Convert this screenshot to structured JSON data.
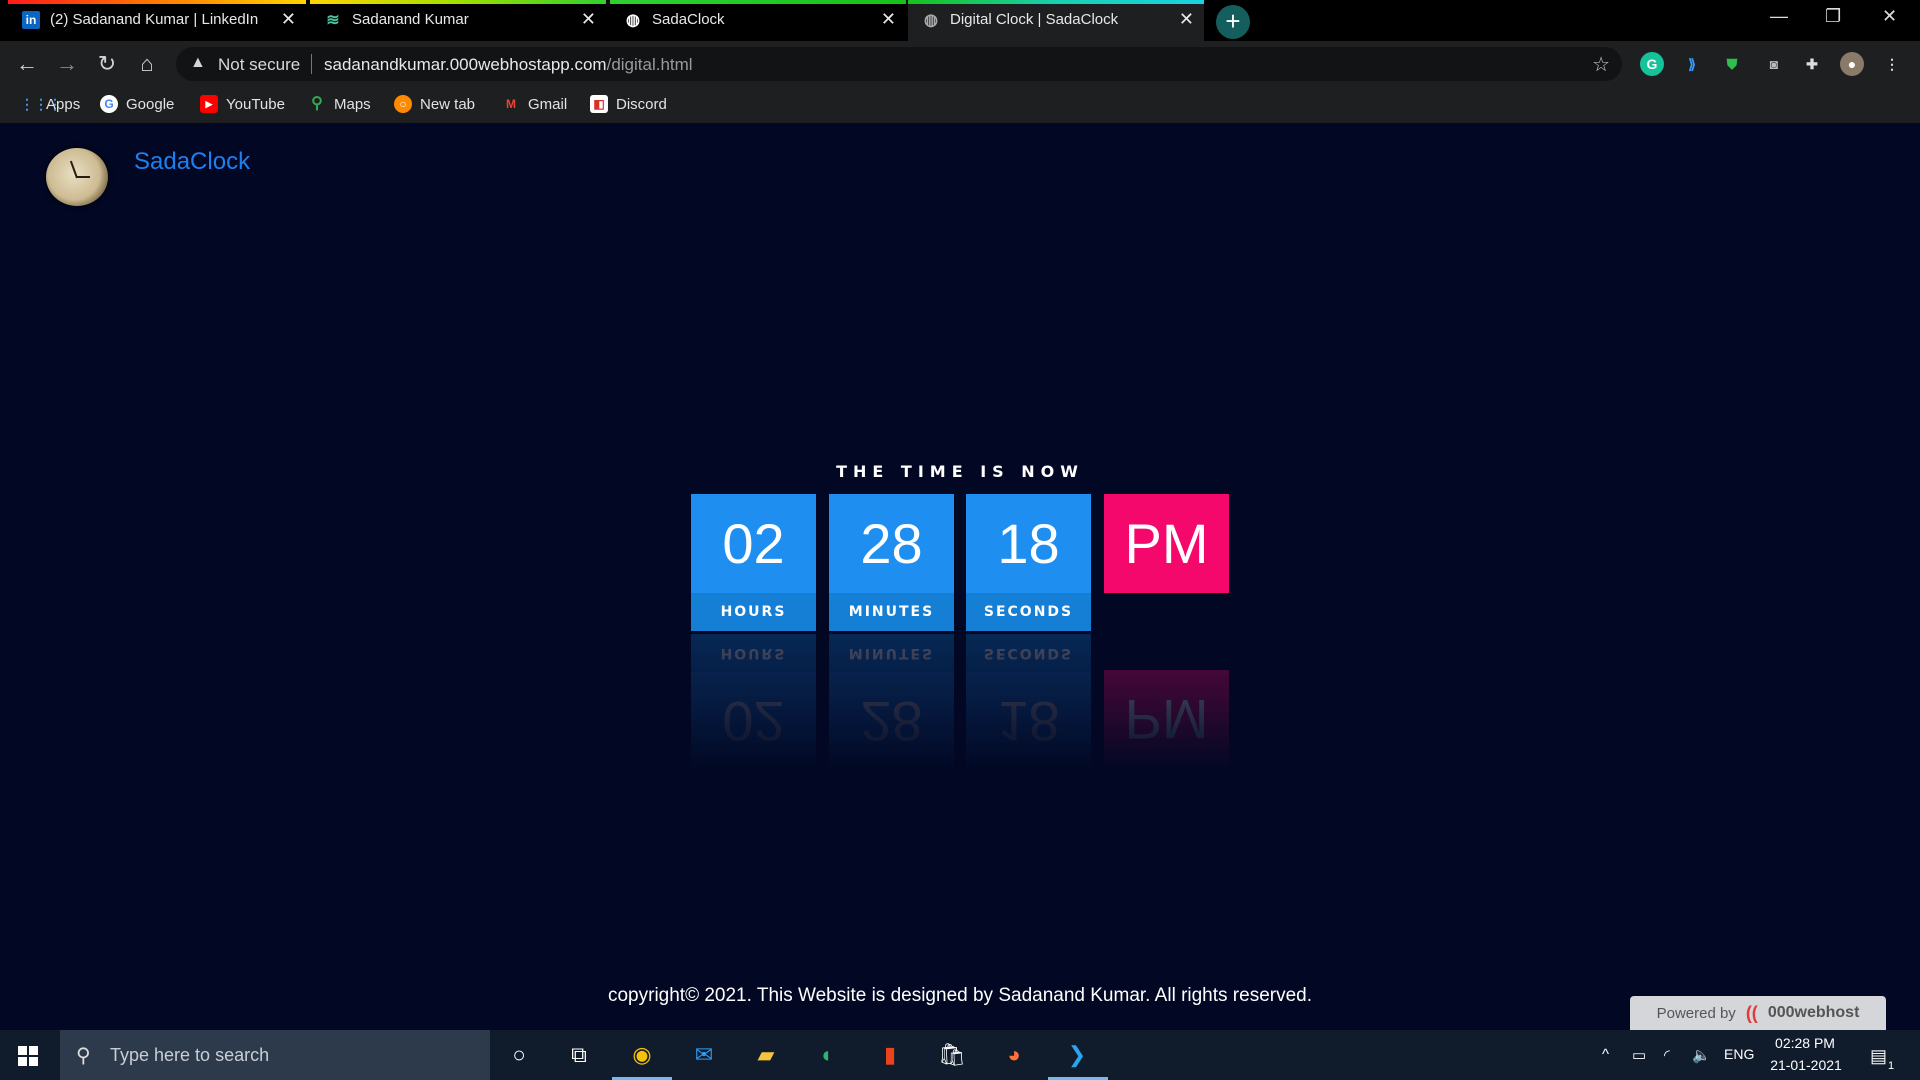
{
  "browser": {
    "tabs": [
      {
        "title": "(2) Sadanand Kumar | LinkedIn",
        "favicon": "linkedin-icon"
      },
      {
        "title": "Sadanand Kumar",
        "favicon": "layers-icon"
      },
      {
        "title": "SadaClock",
        "favicon": "globe-icon"
      },
      {
        "title": "Digital Clock | SadaClock",
        "favicon": "globe-icon"
      }
    ],
    "new_tab": "+",
    "security_label": "Not secure",
    "url_host": "sadanandkumar.000webhostapp.com",
    "url_path": "/digital.html",
    "bookmarks": [
      "Apps",
      "Google",
      "YouTube",
      "Maps",
      "New tab",
      "Gmail",
      "Discord"
    ]
  },
  "site": {
    "brand": "SadaClock"
  },
  "clock": {
    "heading": "THE TIME IS NOW",
    "hours": "02",
    "minutes": "28",
    "seconds": "18",
    "meridiem": "PM",
    "hours_label": "HOURS",
    "minutes_label": "MINUTES",
    "seconds_label": "SECONDS"
  },
  "footer": {
    "copyright": "copyright© 2021. This Website is designed by Sadanand Kumar. All rights reserved.",
    "powered_by": "Powered by",
    "host_brand": "000webhost"
  },
  "taskbar": {
    "search_placeholder": "Type here to search",
    "language": "ENG",
    "time": "02:28 PM",
    "date": "21-01-2021",
    "notification_count": "1"
  },
  "colors": {
    "page_background": "#020824",
    "unit_blue": "#1e8ff0",
    "meridiem_pink": "#f4086b",
    "brand_blue": "#1d7ff0"
  }
}
